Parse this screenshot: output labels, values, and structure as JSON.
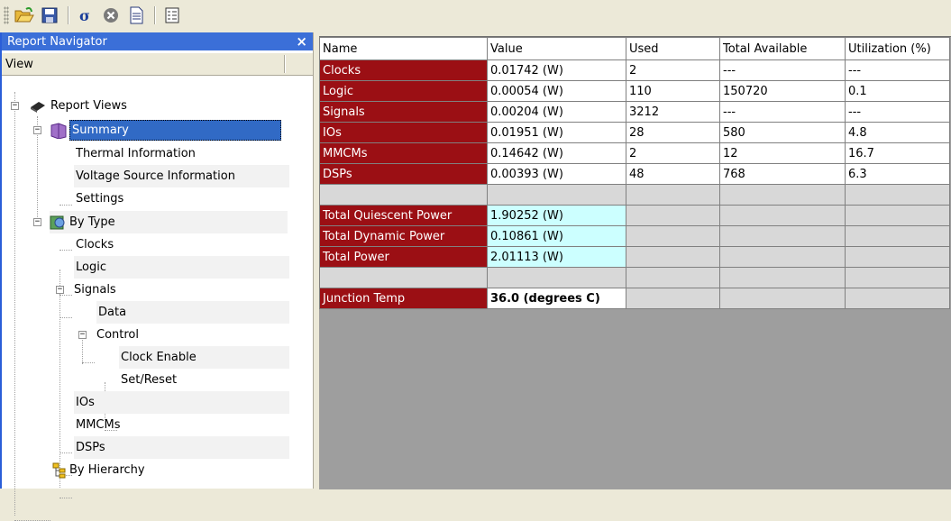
{
  "panel": {
    "title": "Report Navigator",
    "close_label": "×",
    "view_label": "View"
  },
  "tree": {
    "root": "Report Views",
    "summary": "Summary",
    "thermal": "Thermal Information",
    "voltage": "Voltage Source Information",
    "settings": "Settings",
    "by_type": "By Type",
    "clocks": "Clocks",
    "logic": "Logic",
    "signals": "Signals",
    "data": "Data",
    "control": "Control",
    "clock_enable": "Clock Enable",
    "set_reset": "Set/Reset",
    "ios": "IOs",
    "mmcms": "MMCMs",
    "dsps": "DSPs",
    "by_hierarchy": "By Hierarchy"
  },
  "table": {
    "headers": [
      "Name",
      "Value",
      "Used",
      "Total Available",
      "Utilization (%)"
    ],
    "rows": [
      [
        "Clocks",
        "0.01742 (W)",
        "2",
        "---",
        "---"
      ],
      [
        "Logic",
        "0.00054 (W)",
        "110",
        "150720",
        "0.1"
      ],
      [
        "Signals",
        "0.00204 (W)",
        "3212",
        "---",
        "---"
      ],
      [
        "IOs",
        "0.01951 (W)",
        "28",
        "580",
        "4.8"
      ],
      [
        "MMCMs",
        "0.14642 (W)",
        "2",
        "12",
        "16.7"
      ],
      [
        "DSPs",
        "0.00393 (W)",
        "48",
        "768",
        "6.3"
      ]
    ],
    "totals": [
      [
        "Total Quiescent Power",
        "1.90252 (W)"
      ],
      [
        "Total Dynamic Power",
        "0.10861 (W)"
      ],
      [
        "Total Power",
        "2.01113 (W)"
      ]
    ],
    "junction": [
      "Junction Temp",
      "36.0 (degrees C)"
    ]
  },
  "colors": {
    "name_cell": "#9b0f14",
    "total_cell": "#ccffff",
    "selection": "#316ac5",
    "panel_title": "#3b6fd8"
  }
}
